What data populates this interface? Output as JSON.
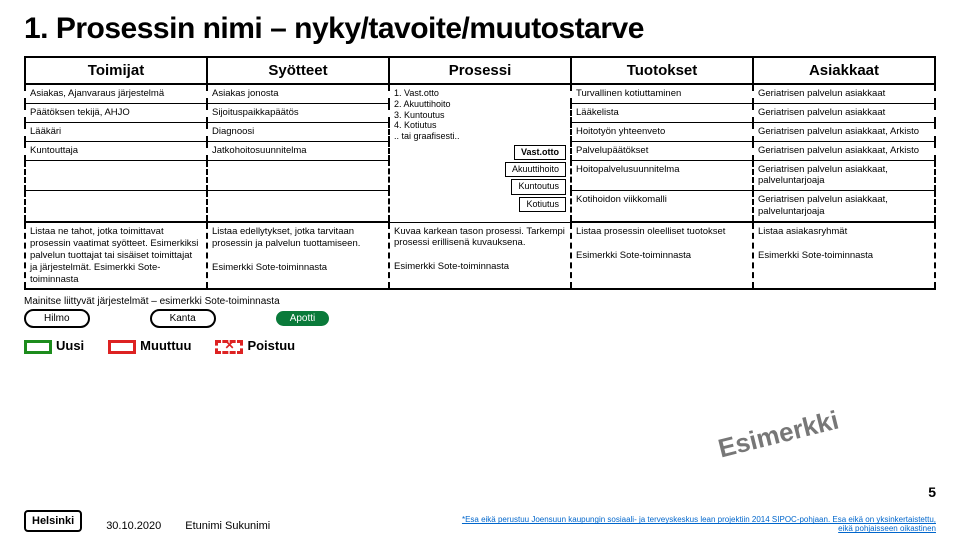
{
  "title": "1. Prosessin nimi – nyky/tavoite/muutostarve",
  "headers": [
    "Toimijat",
    "Syötteet",
    "Prosessi",
    "Tuotokset",
    "Asiakkaat"
  ],
  "rows": [
    {
      "toimijat": "Asiakas, Ajanvaraus järjestelmä",
      "syotteet": "Asiakas jonosta",
      "tuotokset": "Turvallinen kotiuttaminen",
      "asiakkaat": "Geriatrisen palvelun asiakkaat"
    },
    {
      "toimijat": "Päätöksen tekijä, AHJO",
      "syotteet": "Sijoituspaikkapäätös",
      "tuotokset": "Lääkelista",
      "asiakkaat": "Geriatrisen palvelun asiakkaat"
    },
    {
      "toimijat": "Lääkäri",
      "syotteet": "Diagnoosi",
      "tuotokset": "Hoitotyön yhteenveto",
      "asiakkaat": "Geriatrisen palvelun asiakkaat, Arkisto"
    },
    {
      "toimijat": "Kuntouttaja",
      "syotteet": "Jatkohoitosuunnitelma",
      "tuotokset": "Palvelupäätökset",
      "asiakkaat": "Geriatrisen palvelun asiakkaat, Arkisto"
    },
    {
      "toimijat": "",
      "syotteet": "",
      "tuotokset": "Hoitopalvelusuunnitelma",
      "asiakkaat": "Geriatrisen palvelun asiakkaat, palveluntarjoaja"
    },
    {
      "toimijat": "",
      "syotteet": "",
      "tuotokset": "Kotihoidon viikkomalli",
      "asiakkaat": "Geriatrisen palvelun asiakkaat, palveluntarjoaja"
    }
  ],
  "process": {
    "list": "1. Vast.otto\n2. Akuuttihoito\n3. Kuntoutus\n4. Kotiutus\n.. tai graafisesti..",
    "boxes": [
      "Vast.otto",
      "Akuuttihoito",
      "Kuntoutus",
      "Kotiutus"
    ]
  },
  "desc": {
    "toimijat": "Listaa ne tahot, jotka toimittavat prosessin vaatimat syötteet. Esimerkiksi palvelun tuottajat tai sisäiset toimittajat ja järjestelmät. Esimerkki Sote-toiminnasta",
    "syotteet": "Listaa edellytykset, jotka tarvitaan prosessin ja palvelun tuottamiseen.\n\nEsimerkki Sote-toiminnasta",
    "prosessi": "Kuvaa karkean tason prosessi. Tarkempi prosessi erillisenä kuvauksena.\n\nEsimerkki Sote-toiminnasta",
    "tuotokset": "Listaa prosessin oleelliset tuotokset\n\nEsimerkki Sote-toiminnasta",
    "asiakkaat": "Listaa asiakasryhmät\n\nEsimerkki Sote-toiminnasta"
  },
  "systems": {
    "label": "Mainitse liittyvät järjestelmät – esimerkki Sote-toiminnasta",
    "items": [
      "Hilmo",
      "Kanta",
      "Apotti"
    ]
  },
  "legend": {
    "new": "Uusi",
    "change": "Muuttuu",
    "remove": "Poistuu"
  },
  "stamp": "Esimerkki",
  "footer": {
    "logo": "Helsinki",
    "date": "30.10.2020",
    "author": "Etunimi Sukunimi"
  },
  "pagenum": "5",
  "footnote": "*Esa eikä perustuu Joensuun kaupungin sosiaali- ja terveyskeskus lean projektiin 2014 SIPOC-pohjaan. Esa eikä on yksinkertaistettu, eikä pohjaisseen oikastinen"
}
